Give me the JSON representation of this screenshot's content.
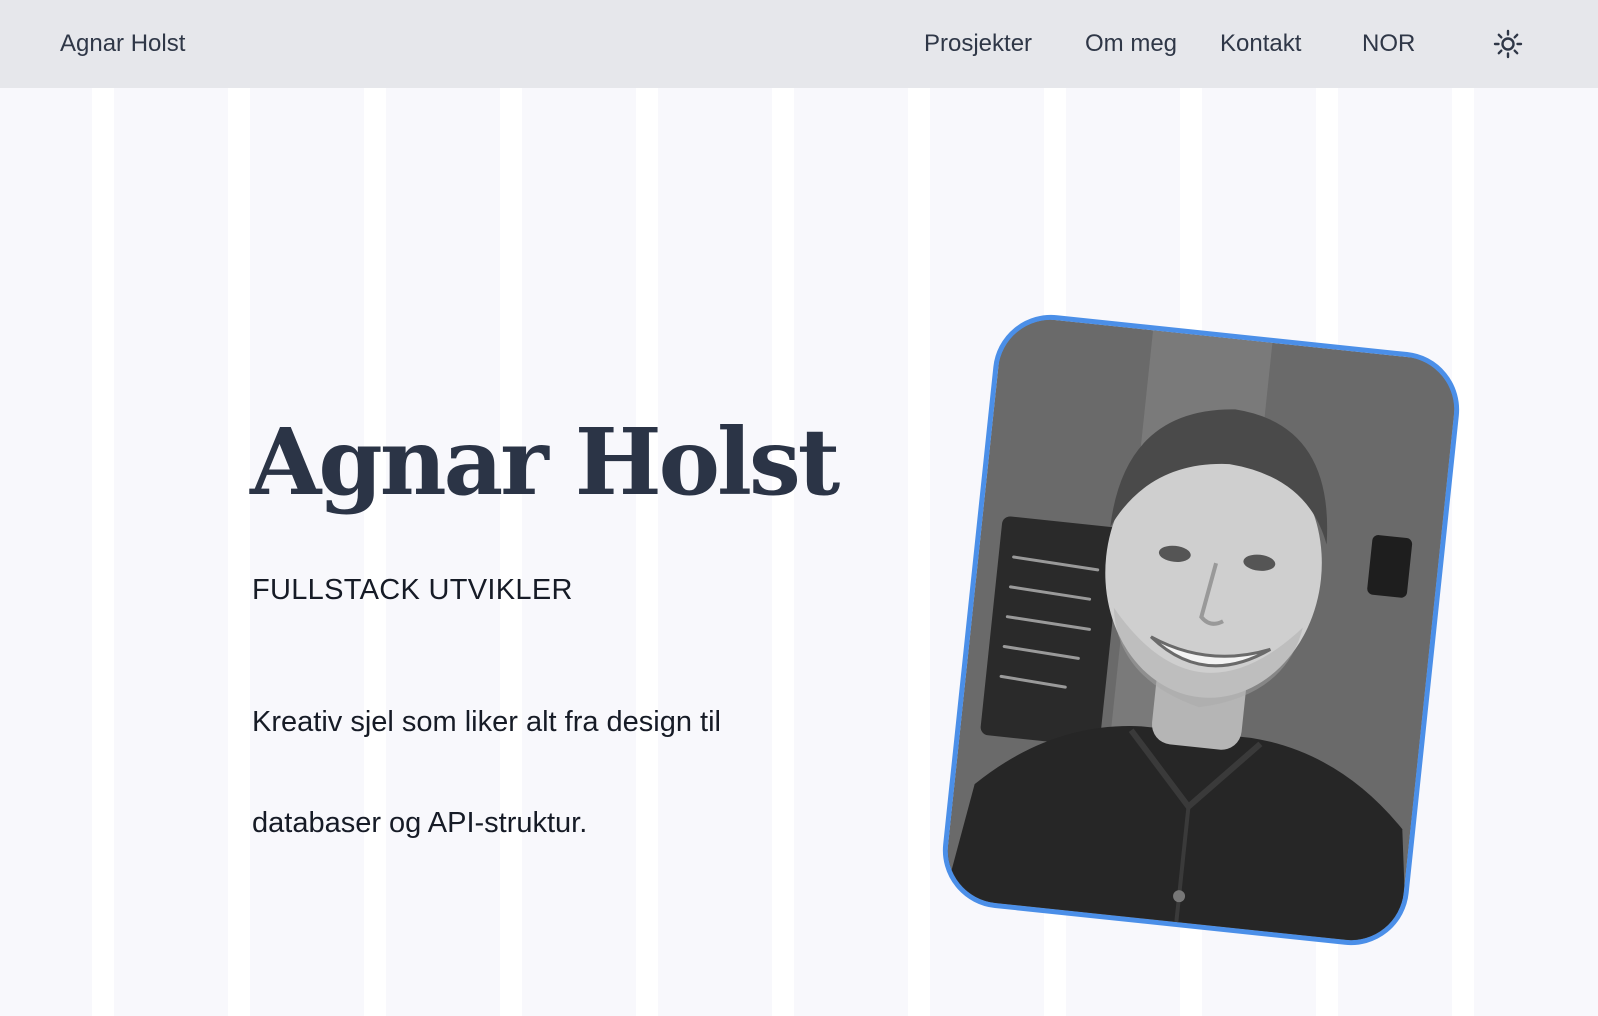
{
  "navbar": {
    "brand": "Agnar Holst",
    "links": [
      "Prosjekter",
      "Om meg",
      "Kontakt"
    ],
    "language": "NOR",
    "theme_icon": "sun-icon"
  },
  "hero": {
    "title": "Agnar Holst",
    "role": "FULLSTACK UTVIKLER",
    "description": "Kreativ sjel som liker alt fra design til databaser og API-struktur."
  },
  "colors": {
    "background": "#f8f8fc",
    "navbar": "#e6e7eb",
    "text": "#2b3446",
    "accent_border": "#4b8fe8"
  },
  "portrait": {
    "icon": "portrait-photo"
  }
}
